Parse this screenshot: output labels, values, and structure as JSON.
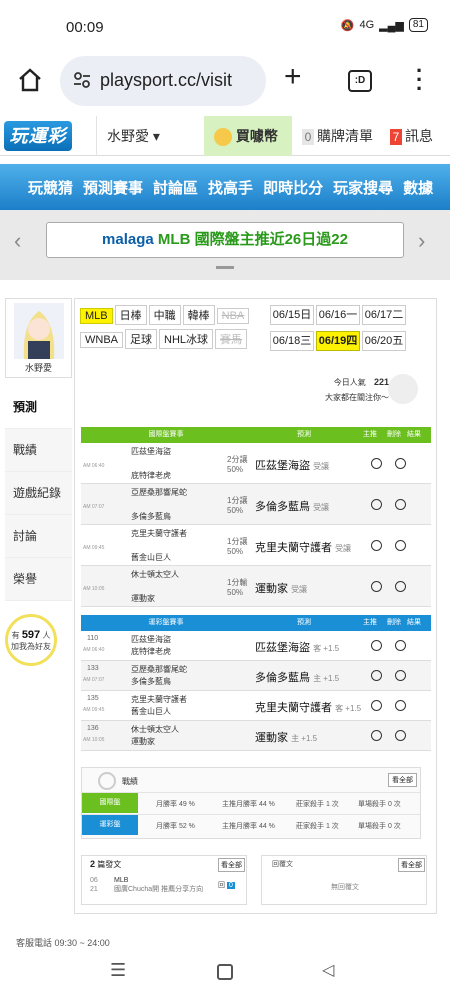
{
  "status": {
    "time": "00:09",
    "signal": "4G",
    "battery": "81"
  },
  "browser": {
    "url": "playsport.cc/visit",
    "tabs": ":D"
  },
  "header": {
    "logo": "玩運彩",
    "user": "水野愛",
    "coin_label": "買噱幣",
    "cart_count": "0",
    "cart_label": "購牌清單",
    "msg_count": "7",
    "msg_label": "訊息"
  },
  "nav": [
    "玩競猜",
    "預測賽事",
    "討論區",
    "找高手",
    "即時比分",
    "玩家搜尋",
    "數據"
  ],
  "marquee": {
    "user": "malaga",
    "rest": "MLB 國際盤主推近26日過22"
  },
  "profile": {
    "name": "水野愛"
  },
  "sidebar": [
    "預測",
    "戰績",
    "遊戲紀錄",
    "討論",
    "榮譽"
  ],
  "fans": {
    "prefix": "有",
    "count": "597",
    "suffix": "人",
    "line2": "加我為好友"
  },
  "leagues": [
    {
      "n": "MLB",
      "s": 1
    },
    {
      "n": "日棒"
    },
    {
      "n": "中職"
    },
    {
      "n": "韓棒"
    },
    {
      "n": "NBA",
      "d": 1
    },
    {
      "n": "WNBA"
    },
    {
      "n": "足球"
    },
    {
      "n": "NHL冰球"
    },
    {
      "n": "賽馬",
      "d": 1
    }
  ],
  "dates": [
    [
      "06/15",
      "日"
    ],
    [
      "06/16",
      "一"
    ],
    [
      "06/17",
      "二"
    ],
    [
      "06/18",
      "三"
    ],
    [
      "06/19",
      "四"
    ],
    [
      "06/20",
      "五"
    ]
  ],
  "popularity": {
    "label": "今日人氣",
    "value": "221",
    "sub": "大家都在關注你～"
  },
  "table1": {
    "h1": "國際盤賽事",
    "h2": "預測",
    "h3": "主推",
    "h4": "刪除",
    "h5": "結果",
    "rows": [
      {
        "time": "AM 06:40",
        "t1": "匹茲堡海盜",
        "t2": "底特律老虎",
        "line": "2分讓",
        "pct": "50%",
        "pick": "匹茲堡海盜",
        "tag": "受讓"
      },
      {
        "time": "AM 07:07",
        "t1": "亞歷桑那響尾蛇",
        "t2": "多倫多藍鳥",
        "line": "1分讓",
        "pct": "50%",
        "pick": "多倫多藍鳥",
        "tag": "受讓"
      },
      {
        "time": "AM 09:45",
        "t1": "克里夫蘭守護者",
        "t2": "舊金山巨人",
        "line": "1分讓",
        "pct": "50%",
        "pick": "克里夫蘭守護者",
        "tag": "受讓"
      },
      {
        "time": "AM 10:05",
        "t1": "休士頓太空人",
        "t2": "運動家",
        "line": "1分輸",
        "pct": "50%",
        "pick": "運動家",
        "tag": "受讓"
      }
    ]
  },
  "table2": {
    "h1": "運彩盤賽事",
    "h2": "預測",
    "h3": "主推",
    "h4": "刪除",
    "h5": "結果",
    "rows": [
      {
        "no": "110",
        "time": "AM 06:40",
        "t1": "匹茲堡海盜",
        "t2": "底特律老虎",
        "pick": "匹茲堡海盜",
        "tag": "客 +1.5"
      },
      {
        "no": "133",
        "time": "AM 07:07",
        "t1": "亞歷桑那響尾蛇",
        "t2": "多倫多藍鳥",
        "pick": "多倫多藍鳥",
        "tag": "主 +1.5"
      },
      {
        "no": "135",
        "time": "AM 09:45",
        "t1": "克里夫蘭守護者",
        "t2": "舊金山巨人",
        "pick": "克里夫蘭守護者",
        "tag": "客 +1.5"
      },
      {
        "no": "136",
        "time": "AM 10:05",
        "t1": "休士頓太空人",
        "t2": "運動家",
        "pick": "運動家",
        "tag": "主 +1.5"
      }
    ]
  },
  "record": {
    "title": "戰績",
    "more": "看全部",
    "rows": [
      {
        "name": "國際盤",
        "win": "月勝率 49 %",
        "main": "主推月勝率 44 %",
        "kill": "莊家殺手 1 次",
        "single": "單場殺手 0 次"
      },
      {
        "name": "運彩盤",
        "win": "月勝率 52 %",
        "main": "主推月勝率 44 %",
        "kill": "莊家殺手 1 次",
        "single": "單場殺手 0 次"
      }
    ]
  },
  "posts": {
    "count": "2",
    "title": "篇發文",
    "more": "看全部",
    "date": "06",
    "day": "21",
    "league": "MLB",
    "text": "國廣Chucha開 推薦分享方向",
    "reply_label": "回",
    "reply": "0"
  },
  "replies": {
    "title": "回覆文",
    "more": "看全部",
    "empty": "無回覆文"
  },
  "footer": {
    "service": "客服電話 09:30 ~ 24:00"
  }
}
